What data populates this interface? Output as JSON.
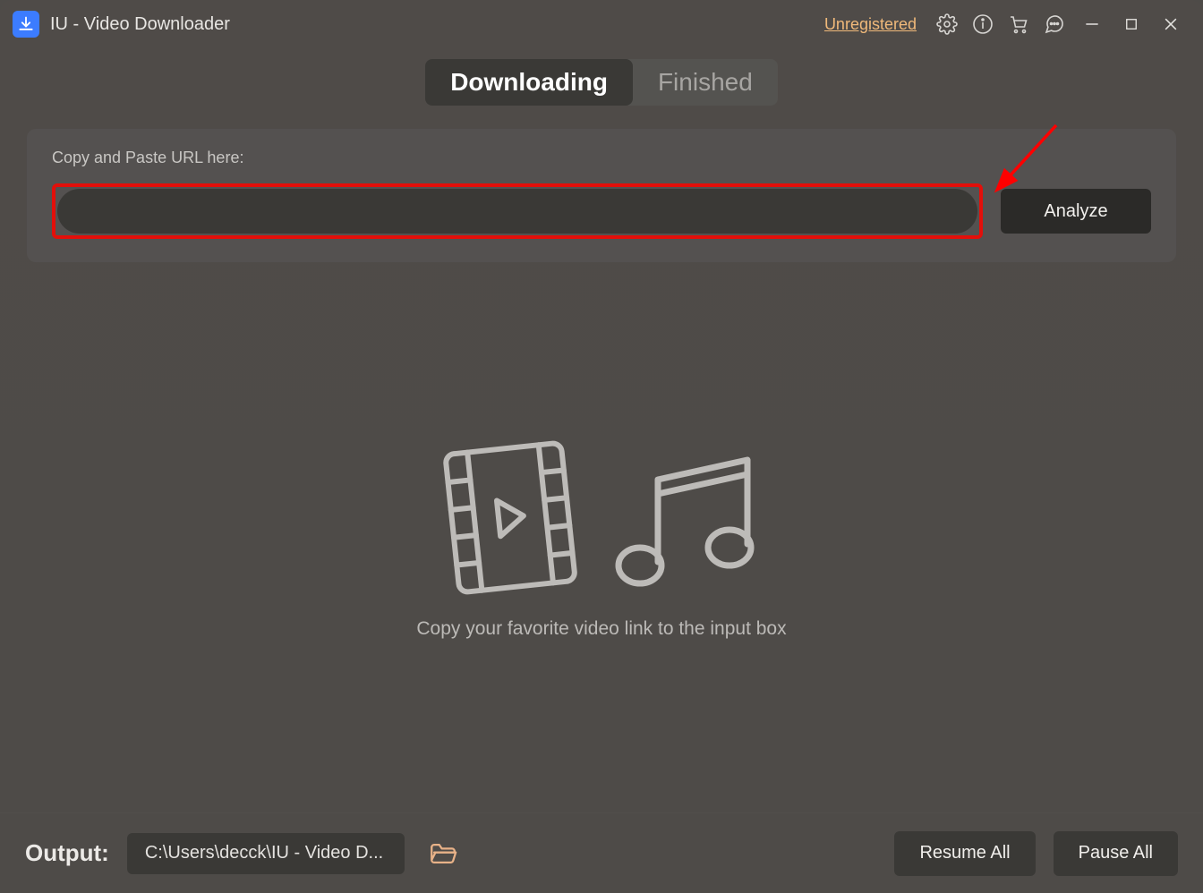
{
  "titlebar": {
    "app_title": "IU - Video Downloader",
    "unregistered_label": "Unregistered"
  },
  "tabs": {
    "downloading": "Downloading",
    "finished": "Finished",
    "active": "downloading"
  },
  "url_panel": {
    "label": "Copy and Paste URL here:",
    "input_value": "",
    "analyze_label": "Analyze"
  },
  "splash": {
    "hint": "Copy your favorite video link to the input box"
  },
  "footer": {
    "output_label": "Output:",
    "output_path": "C:\\Users\\decck\\IU - Video D...",
    "resume_label": "Resume All",
    "pause_label": "Pause All"
  }
}
